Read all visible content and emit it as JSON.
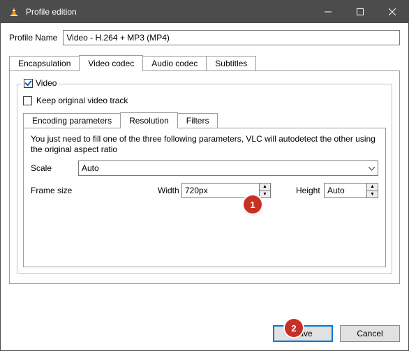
{
  "window": {
    "title": "Profile edition"
  },
  "profileName": {
    "label": "Profile Name",
    "value": "Video - H.264 + MP3 (MP4)"
  },
  "mainTabs": {
    "encapsulation": "Encapsulation",
    "videoCodec": "Video codec",
    "audioCodec": "Audio codec",
    "subtitles": "Subtitles"
  },
  "videoGroup": {
    "legend": "Video",
    "keepOriginal": "Keep original video track"
  },
  "innerTabs": {
    "encodingParams": "Encoding parameters",
    "resolution": "Resolution",
    "filters": "Filters"
  },
  "resolutionPane": {
    "hint": "You just need to fill one of the three following parameters, VLC will autodetect the other using the original aspect ratio",
    "scaleLabel": "Scale",
    "scaleValue": "Auto",
    "frameSizeLabel": "Frame size",
    "widthLabel": "Width",
    "widthValue": "720px",
    "heightLabel": "Height",
    "heightValue": "Auto"
  },
  "buttons": {
    "save": "Save",
    "cancel": "Cancel"
  },
  "callouts": {
    "one": "1",
    "two": "2"
  }
}
